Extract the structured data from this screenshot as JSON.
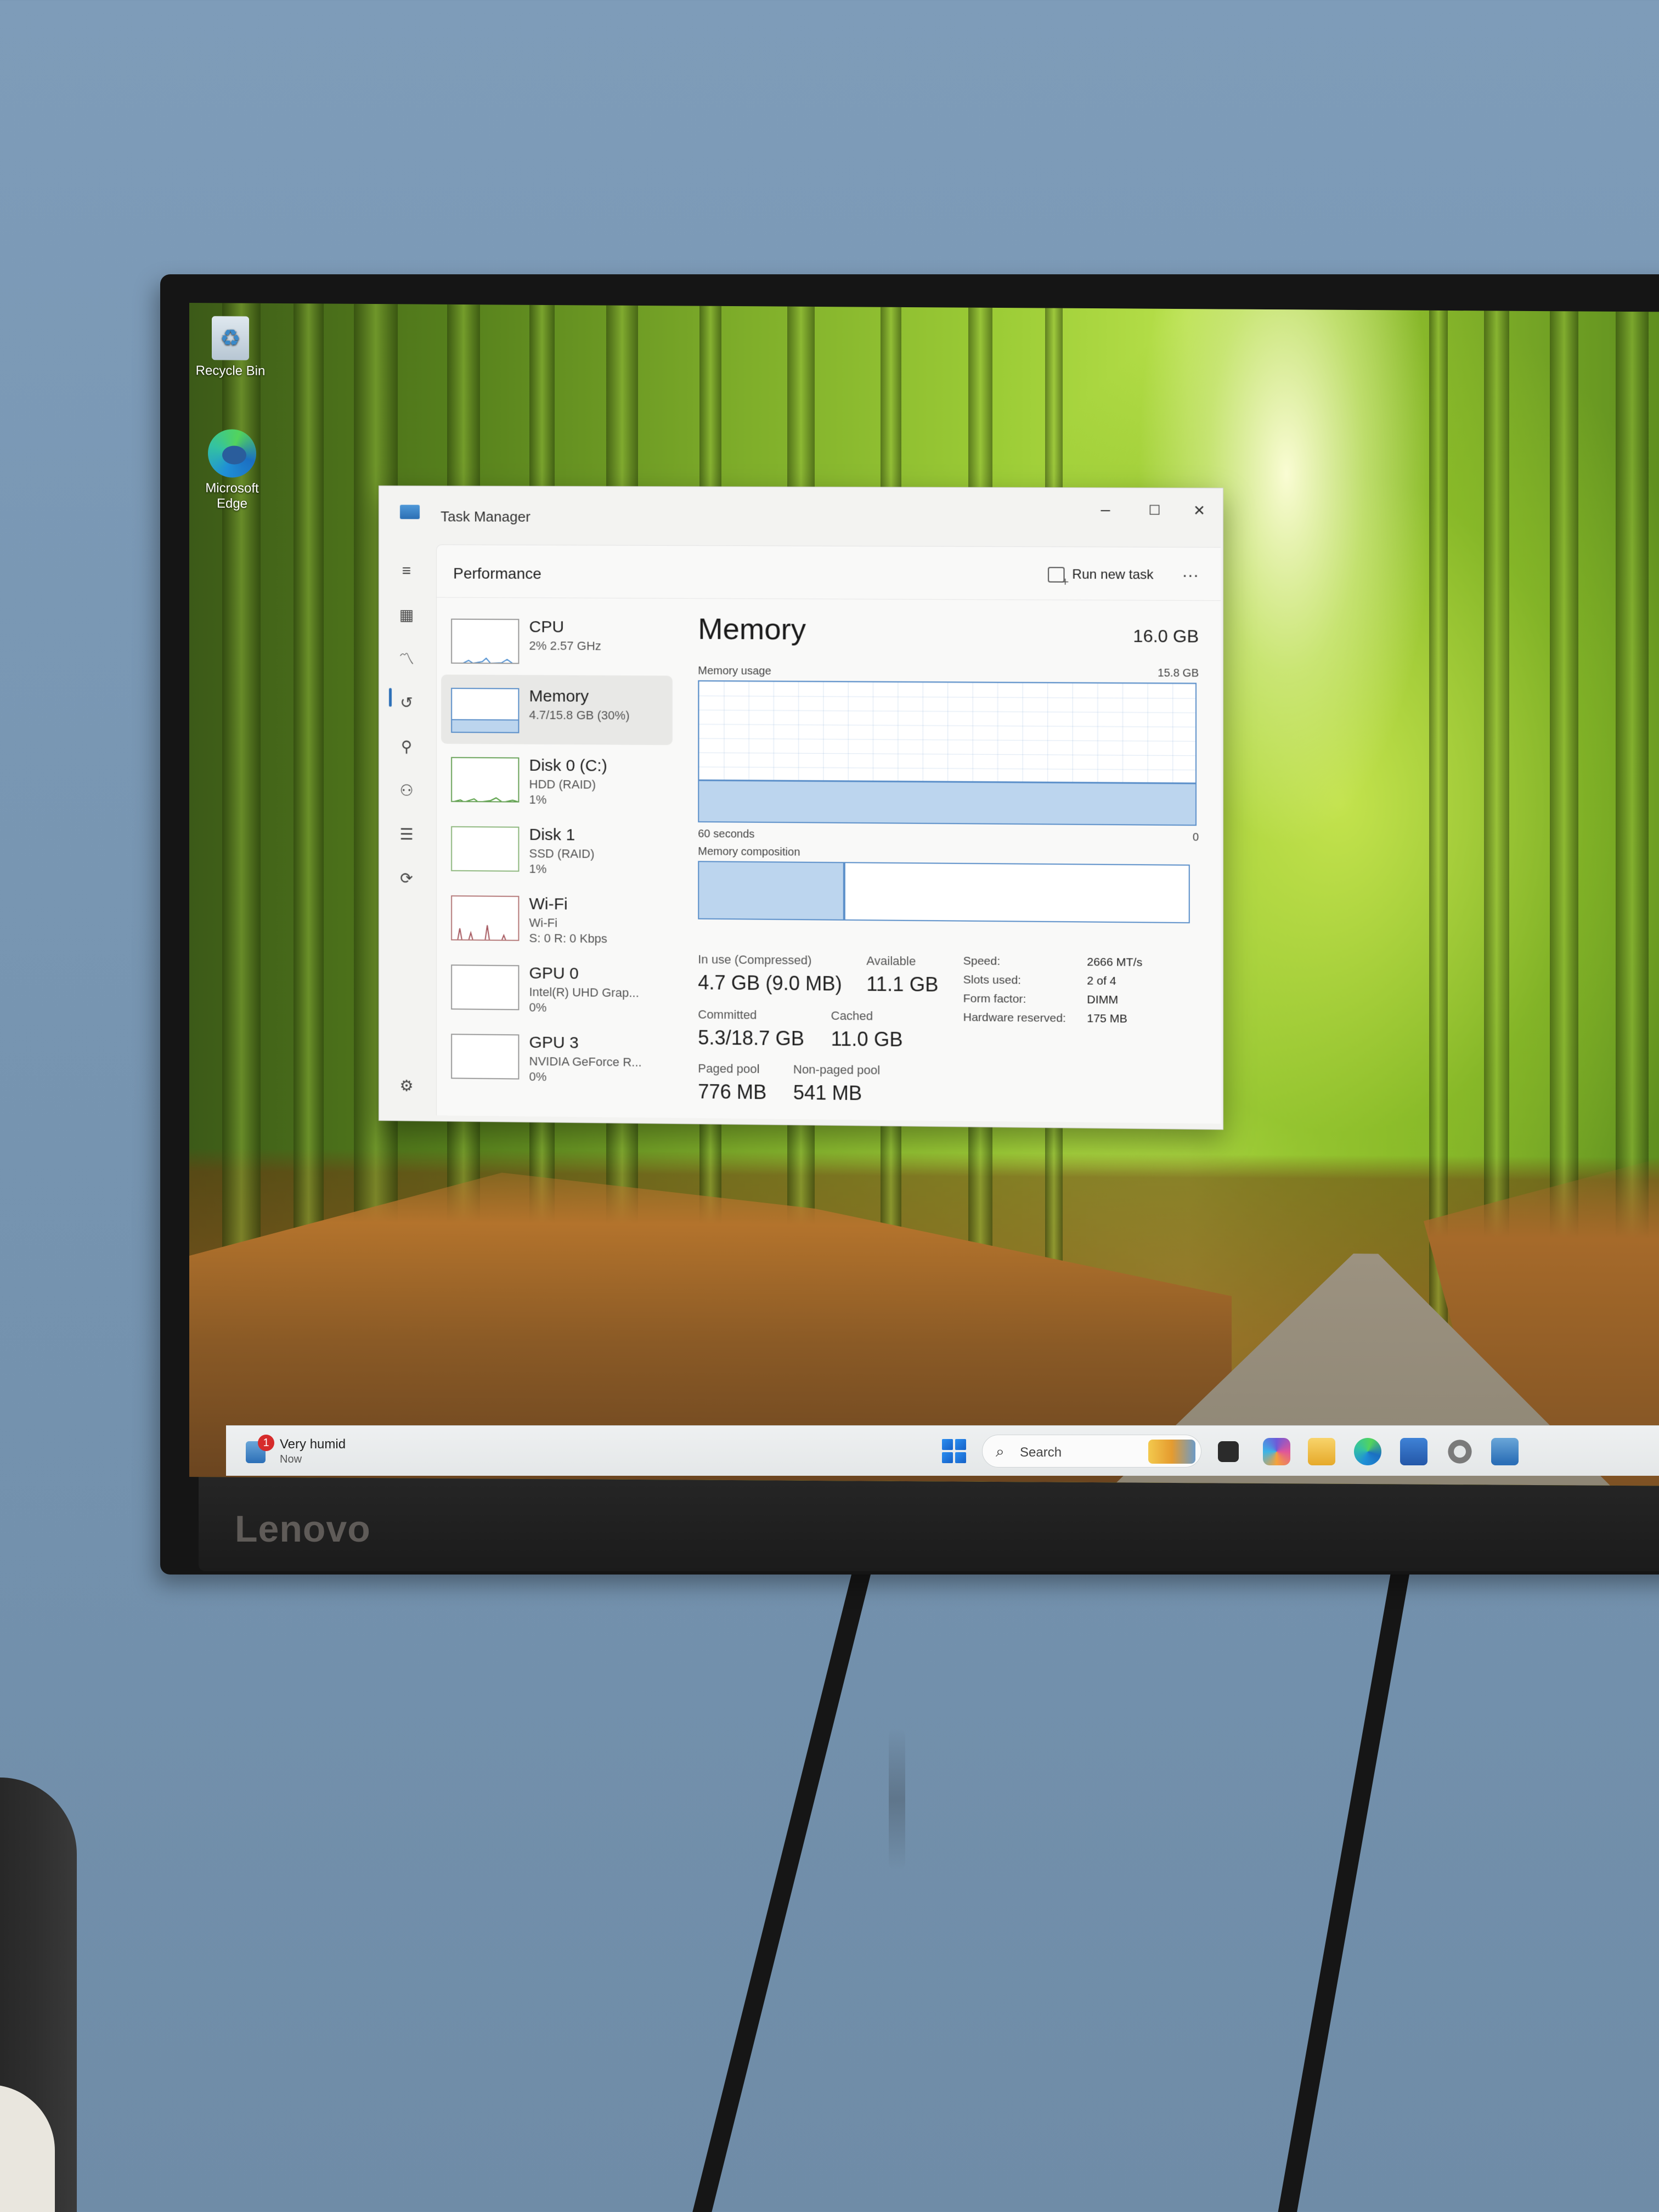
{
  "desktop": {
    "icons": [
      {
        "label": "Recycle Bin",
        "icon": "recycle-bin-icon"
      },
      {
        "label": "Microsoft Edge",
        "icon": "edge-browser-icon"
      }
    ]
  },
  "monitor": {
    "brand": "Lenovo"
  },
  "task_manager": {
    "window_title": "Task Manager",
    "controls": {
      "minimize": "–",
      "maximize": "☐",
      "close": "✕"
    },
    "page_title": "Performance",
    "run_new_task_label": "Run new task",
    "more_label": "···",
    "rail_icons": [
      "hamburger-menu-icon",
      "processes-icon",
      "performance-icon",
      "app-history-icon",
      "startup-apps-icon",
      "users-icon",
      "details-icon",
      "services-icon",
      "settings-icon"
    ],
    "resources": [
      {
        "name": "CPU",
        "line1": "2% 2.57 GHz",
        "line2": "",
        "selected": false
      },
      {
        "name": "Memory",
        "line1": "4.7/15.8 GB (30%)",
        "line2": "",
        "selected": true
      },
      {
        "name": "Disk 0 (C:)",
        "line1": "HDD (RAID)",
        "line2": "1%",
        "selected": false
      },
      {
        "name": "Disk 1",
        "line1": "SSD (RAID)",
        "line2": "1%",
        "selected": false
      },
      {
        "name": "Wi-Fi",
        "line1": "Wi-Fi",
        "line2": "S: 0 R: 0 Kbps",
        "selected": false
      },
      {
        "name": "GPU 0",
        "line1": "Intel(R) UHD Grap...",
        "line2": "0%",
        "selected": false
      },
      {
        "name": "GPU 3",
        "line1": "NVIDIA GeForce R...",
        "line2": "0%",
        "selected": false
      }
    ],
    "memory": {
      "title": "Memory",
      "total": "16.0 GB",
      "usage_label": "Memory usage",
      "usage_max": "15.8 GB",
      "time_label": "60 seconds",
      "time_end": "0",
      "usage_fraction": 0.3,
      "composition_label": "Memory composition",
      "composition_in_use_fraction": 0.3,
      "stats": {
        "in_use_label": "In use (Compressed)",
        "in_use_value": "4.7 GB (9.0 MB)",
        "available_label": "Available",
        "available_value": "11.1 GB",
        "committed_label": "Committed",
        "committed_value": "5.3/18.7 GB",
        "cached_label": "Cached",
        "cached_value": "11.0 GB",
        "paged_label": "Paged pool",
        "paged_value": "776 MB",
        "nonpaged_label": "Non-paged pool",
        "nonpaged_value": "541 MB"
      },
      "specs": {
        "speed_label": "Speed:",
        "speed_value": "2666 MT/s",
        "slots_label": "Slots used:",
        "slots_value": "2 of 4",
        "form_label": "Form factor:",
        "form_value": "DIMM",
        "reserved_label": "Hardware reserved:",
        "reserved_value": "175 MB"
      }
    }
  },
  "taskbar": {
    "weather_badge": "1",
    "weather_text": "Very humid",
    "weather_time": "Now",
    "search_placeholder": "Search",
    "pinned": [
      "start-button",
      "task-view-icon",
      "copilot-icon",
      "file-explorer-icon",
      "edge-browser-icon",
      "microsoft-store-icon",
      "settings-gear-icon",
      "task-manager-icon"
    ]
  },
  "colors": {
    "accent": "#5b8fc9",
    "memory_fill": "#bcd5ee",
    "wall": "#7896b2"
  }
}
